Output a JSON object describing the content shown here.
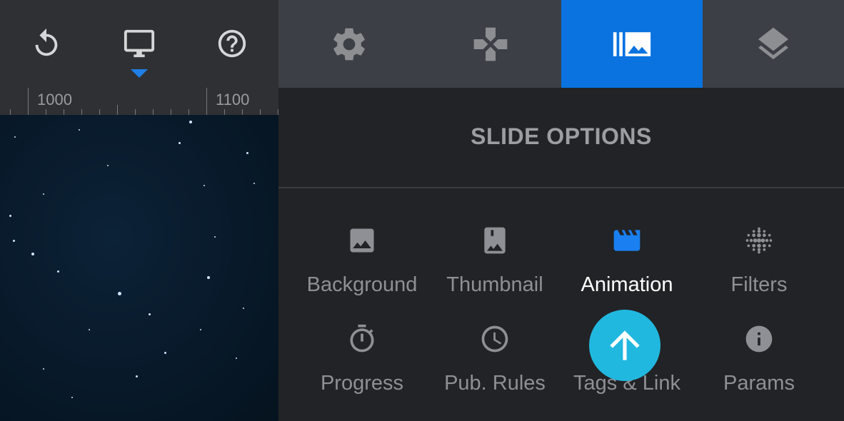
{
  "toolbar": {
    "buttons": [
      {
        "icon": "undo-icon"
      },
      {
        "icon": "desktop-icon",
        "active": true
      },
      {
        "icon": "help-icon"
      }
    ]
  },
  "tabs": [
    {
      "icon": "gear-icon"
    },
    {
      "icon": "gamepad-icon"
    },
    {
      "icon": "slides-icon",
      "active": true
    },
    {
      "icon": "layers-icon"
    }
  ],
  "ruler": {
    "labels": [
      "1000",
      "1100"
    ]
  },
  "panel": {
    "title": "SLIDE OPTIONS",
    "options": [
      {
        "label": "Background",
        "icon": "image-icon"
      },
      {
        "label": "Thumbnail",
        "icon": "bookmark-image-icon"
      },
      {
        "label": "Animation",
        "icon": "clapper-icon",
        "active": true
      },
      {
        "label": "Filters",
        "icon": "dots-grid-icon"
      },
      {
        "label": "Progress",
        "icon": "stopwatch-icon"
      },
      {
        "label": "Pub. Rules",
        "icon": "clock-icon"
      },
      {
        "label": "Tags & Link",
        "icon": "tag-link-icon"
      },
      {
        "label": "Params",
        "icon": "info-icon"
      }
    ]
  },
  "scroll_top": {
    "icon": "arrow-up-icon"
  },
  "colors": {
    "accent": "#0a73e0",
    "fab": "#21b8e0",
    "icon_grey": "#9c9ea2"
  }
}
